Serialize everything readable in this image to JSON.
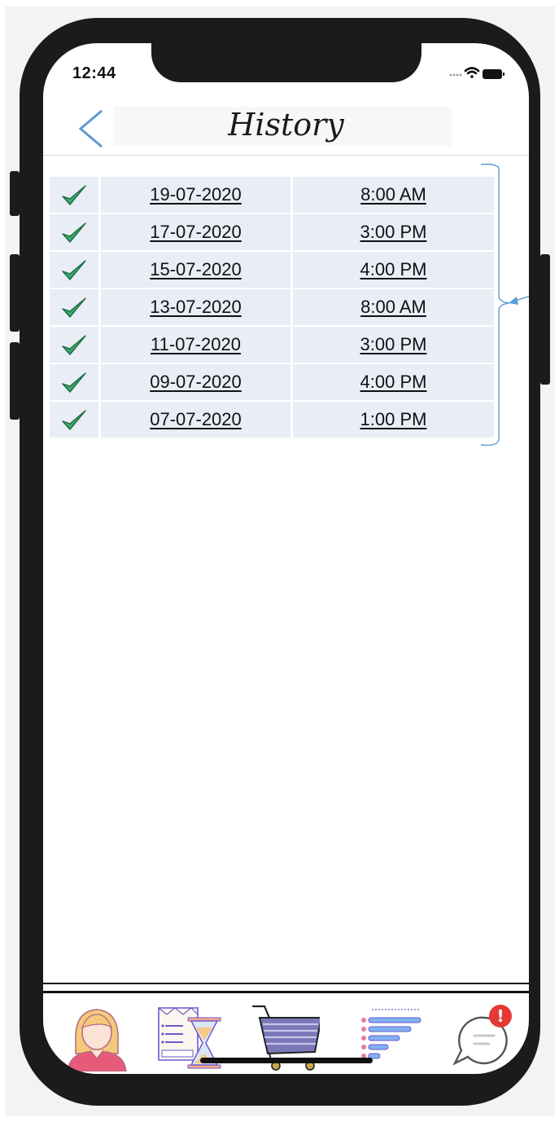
{
  "status_bar": {
    "time": "12:44"
  },
  "header": {
    "title": "History",
    "back_icon": "chevron-left-icon"
  },
  "history": {
    "rows": [
      {
        "date": "19-07-2020",
        "time": "8:00 AM",
        "status_icon": "checkmark-icon"
      },
      {
        "date": "17-07-2020",
        "time": "3:00 PM",
        "status_icon": "checkmark-icon"
      },
      {
        "date": "15-07-2020",
        "time": "4:00 PM",
        "status_icon": "checkmark-icon"
      },
      {
        "date": "13-07-2020",
        "time": "8:00 AM",
        "status_icon": "checkmark-icon"
      },
      {
        "date": "11-07-2020",
        "time": "3:00 PM",
        "status_icon": "checkmark-icon"
      },
      {
        "date": "09-07-2020",
        "time": "4:00 PM",
        "status_icon": "checkmark-icon"
      },
      {
        "date": "07-07-2020",
        "time": "1:00 PM",
        "status_icon": "checkmark-icon"
      }
    ]
  },
  "tabbar": {
    "items": [
      {
        "icon": "user-profile-icon"
      },
      {
        "icon": "history-hourglass-icon"
      },
      {
        "icon": "shopping-cart-icon"
      },
      {
        "icon": "list-filter-icon"
      },
      {
        "icon": "chat-notification-icon",
        "badge": "!"
      }
    ]
  },
  "colors": {
    "accent_blue": "#5b9bd5",
    "row_background": "#e8edf6",
    "check_green": "#3aa86b",
    "badge_red": "#e53935"
  }
}
